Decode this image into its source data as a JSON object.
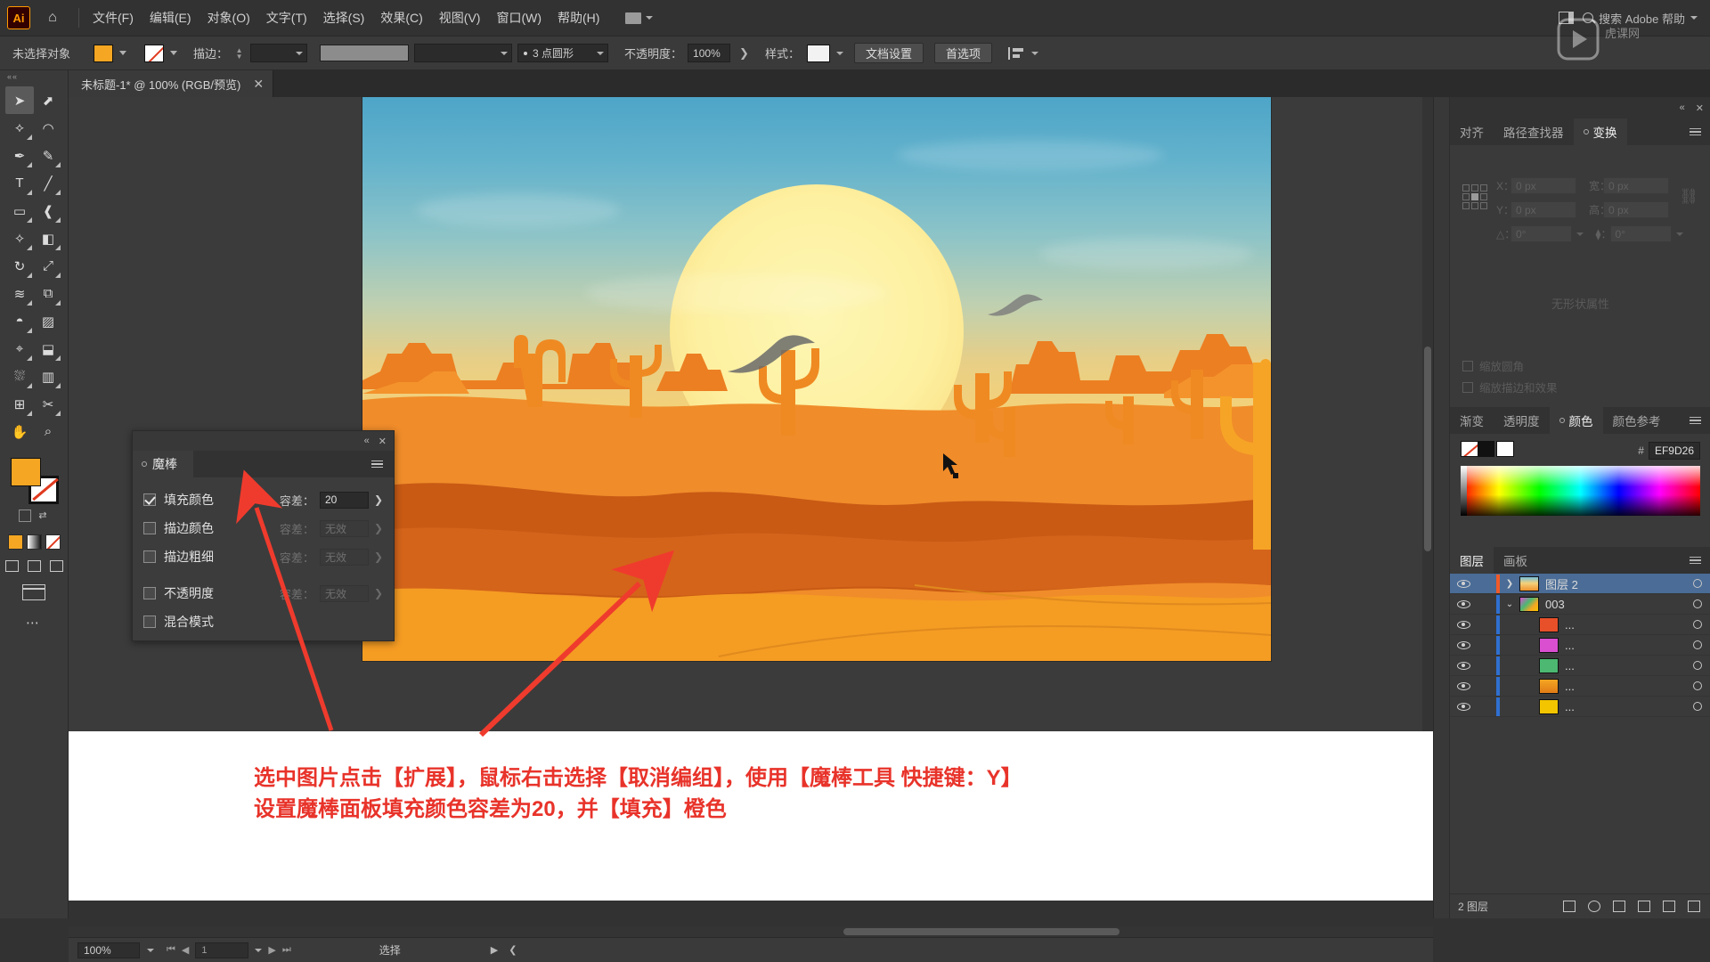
{
  "app": {
    "logo_text": "Ai",
    "home_icon": "home-icon"
  },
  "menubar": {
    "items": [
      {
        "label": "文件(F)"
      },
      {
        "label": "编辑(E)"
      },
      {
        "label": "对象(O)"
      },
      {
        "label": "文字(T)"
      },
      {
        "label": "选择(S)"
      },
      {
        "label": "效果(C)"
      },
      {
        "label": "视图(V)"
      },
      {
        "label": "窗口(W)"
      },
      {
        "label": "帮助(H)"
      }
    ],
    "search_placeholder": "搜索 Adobe 帮助"
  },
  "controlbar": {
    "selection_status": "未选择对象",
    "fill_color": "#F5A623",
    "stroke_label": "描边：",
    "stroke_weight": "",
    "brush_definition": "",
    "opacity_label": "不透明度：",
    "opacity_value": "100%",
    "style_label": "样式：",
    "brush_profile": "3 点圆形",
    "document_setup": "文档设置",
    "preferences": "首选项"
  },
  "document_tab": {
    "title": "未标题-1* @ 100% (RGB/预览)",
    "close": "✕"
  },
  "toolbar": {
    "tools": [
      {
        "name": "selection-tool",
        "glyph": "➤"
      },
      {
        "name": "direct-selection-tool",
        "glyph": "↗"
      },
      {
        "name": "magic-wand-tool",
        "glyph": "✦"
      },
      {
        "name": "lasso-tool",
        "glyph": "◠"
      },
      {
        "name": "pen-tool",
        "glyph": "✒"
      },
      {
        "name": "curvature-tool",
        "glyph": "✎"
      },
      {
        "name": "type-tool",
        "glyph": "T"
      },
      {
        "name": "line-segment-tool",
        "glyph": "╱"
      },
      {
        "name": "rectangle-tool",
        "glyph": "▭"
      },
      {
        "name": "paintbrush-tool",
        "glyph": "🖌"
      },
      {
        "name": "shaper-tool",
        "glyph": "✧"
      },
      {
        "name": "eraser-tool",
        "glyph": "◧"
      },
      {
        "name": "rotate-tool",
        "glyph": "↻"
      },
      {
        "name": "scale-tool",
        "glyph": "⤢"
      },
      {
        "name": "width-tool",
        "glyph": "≋"
      },
      {
        "name": "free-transform-tool",
        "glyph": "⧉"
      },
      {
        "name": "shape-builder-tool",
        "glyph": "◑"
      },
      {
        "name": "gradient-tool",
        "glyph": "▦"
      },
      {
        "name": "eyedropper-tool",
        "glyph": "⌖"
      },
      {
        "name": "blend-tool",
        "glyph": "⬓"
      },
      {
        "name": "symbol-sprayer-tool",
        "glyph": "⛆"
      },
      {
        "name": "column-graph-tool",
        "glyph": "▮"
      },
      {
        "name": "artboard-tool",
        "glyph": "⊞"
      },
      {
        "name": "slice-tool",
        "glyph": "✂"
      },
      {
        "name": "hand-tool",
        "glyph": "✋"
      },
      {
        "name": "zoom-tool",
        "glyph": "🔍"
      }
    ],
    "fill_color": "#F5A623",
    "stroke_color": "#FFFFFF",
    "more_tools": "⋯"
  },
  "magic_wand_panel": {
    "title": "魔棒",
    "rows": [
      {
        "label": "填充颜色",
        "checked": true,
        "tol_label": "容差：",
        "tol_value": "20",
        "enabled": true
      },
      {
        "label": "描边颜色",
        "checked": false,
        "tol_label": "容差：",
        "tol_value": "无效",
        "enabled": false
      },
      {
        "label": "描边粗细",
        "checked": false,
        "tol_label": "容差：",
        "tol_value": "无效",
        "enabled": false
      },
      {
        "label": "不透明度",
        "checked": false,
        "tol_label": "容差：",
        "tol_value": "无效",
        "enabled": false
      },
      {
        "label": "混合模式",
        "checked": false,
        "tol_label": "",
        "tol_value": "",
        "enabled": false
      }
    ],
    "collapse": "«",
    "close": "✕"
  },
  "transform_panel": {
    "tabs": [
      {
        "label": "对齐",
        "active": false
      },
      {
        "label": "路径查找器",
        "active": false
      },
      {
        "label": "变换",
        "active": true
      }
    ],
    "fields": [
      {
        "label": "X：",
        "value": "0 px"
      },
      {
        "label": "宽：",
        "value": "0 px"
      },
      {
        "label": "Y：",
        "value": "0 px"
      },
      {
        "label": "高：",
        "value": "0 px"
      },
      {
        "label": "△：",
        "value": "0°"
      },
      {
        "label": "⧫：",
        "value": "0°"
      }
    ],
    "no_properties": "无形状属性",
    "checkboxes": [
      {
        "label": "缩放圆角"
      },
      {
        "label": "缩放描边和效果"
      }
    ]
  },
  "color_panel": {
    "tabs": [
      {
        "label": "渐变",
        "active": false
      },
      {
        "label": "透明度",
        "active": false
      },
      {
        "label": "颜色",
        "active": true
      },
      {
        "label": "颜色参考",
        "active": false
      }
    ],
    "hex_symbol": "#",
    "hex_value": "EF9D26"
  },
  "layers_panel": {
    "tabs": [
      {
        "label": "图层",
        "active": true
      },
      {
        "label": "画板",
        "active": false
      }
    ],
    "rows": [
      {
        "name": "图层 2",
        "selected": true,
        "color": "#f05a28",
        "disclosure": "❯",
        "thumb": "artwork",
        "indent": 0
      },
      {
        "name": "003",
        "selected": false,
        "color": "#2f6fd0",
        "disclosure": "⌄",
        "thumb": "group",
        "indent": 0
      },
      {
        "name": "...",
        "selected": false,
        "color": "#2f6fd0",
        "disclosure": "",
        "thumb": "#e8502a",
        "indent": 1
      },
      {
        "name": "...",
        "selected": false,
        "color": "#2f6fd0",
        "disclosure": "",
        "thumb": "#d94fd0",
        "indent": 1
      },
      {
        "name": "...",
        "selected": false,
        "color": "#2f6fd0",
        "disclosure": "",
        "thumb": "#4cb872",
        "indent": 1
      },
      {
        "name": "...",
        "selected": false,
        "color": "#2f6fd0",
        "disclosure": "",
        "thumb": "#f5a623",
        "indent": 1
      },
      {
        "name": "...",
        "selected": false,
        "color": "#2f6fd0",
        "disclosure": "",
        "thumb": "#f2c500",
        "indent": 1
      }
    ],
    "footer_count": "2 图层",
    "footer_icons": [
      {
        "name": "locate-object-icon"
      },
      {
        "name": "search-layer-icon"
      },
      {
        "name": "make-clipping-mask-icon"
      },
      {
        "name": "create-sublayer-icon"
      },
      {
        "name": "create-layer-icon"
      },
      {
        "name": "delete-layer-icon"
      }
    ]
  },
  "annotation": {
    "line1": "选中图片点击【扩展】，鼠标右击选择【取消编组】，使用【魔棒工具 快捷键：Y】",
    "line2": "设置魔棒面板填充颜色容差为20，并【填充】橙色",
    "color": "#E8332A"
  },
  "statusbar": {
    "zoom": "100%",
    "page": "1",
    "tool": "选择"
  },
  "artwork": {
    "description": "desert-sunset-illustration",
    "sun_color": "#FDF0A0",
    "sand_color": "#F5A623",
    "mesa_color": "#E8731E"
  }
}
